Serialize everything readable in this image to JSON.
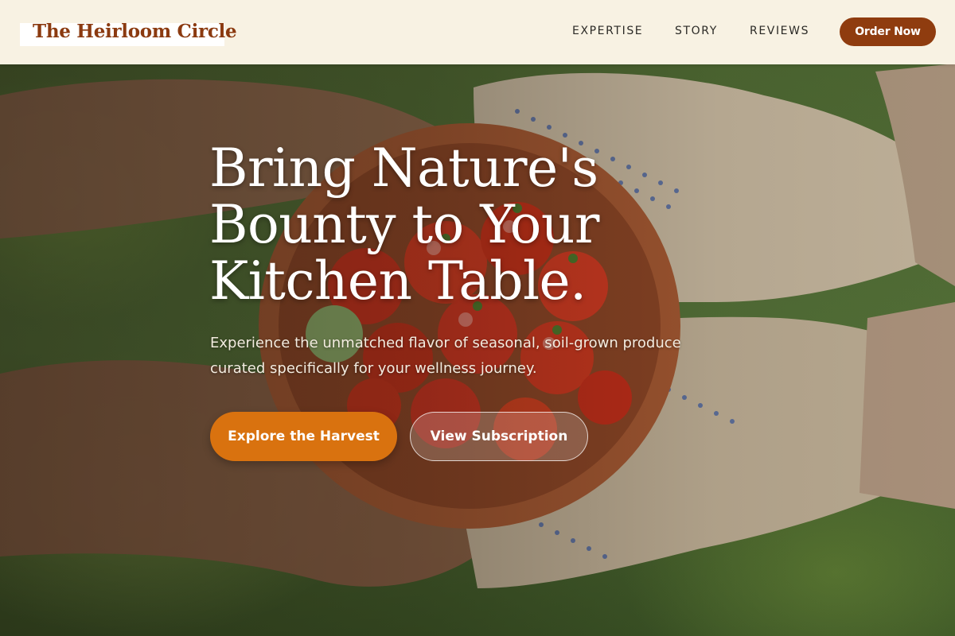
{
  "header": {
    "logo_text": "The Heirloom Circle",
    "nav": [
      {
        "label": "EXPERTISE"
      },
      {
        "label": "STORY"
      },
      {
        "label": "REVIEWS"
      }
    ],
    "cta_label": "Order Now"
  },
  "hero": {
    "headline": "Bring Nature's Bounty to Your Kitchen Table.",
    "subtext": "Experience the unmatched flavor of seasonal, soil-grown produce curated specifically for your wellness journey.",
    "primary_button": "Explore the Harvest",
    "secondary_button": "View Subscription",
    "image_subject": "hands-holding-bowl-of-tomatoes"
  },
  "colors": {
    "header_bg": "#f8f2e3",
    "brand": "#8b3a10",
    "primary_button": "#d9720f",
    "order_button": "#8f3c0f"
  }
}
